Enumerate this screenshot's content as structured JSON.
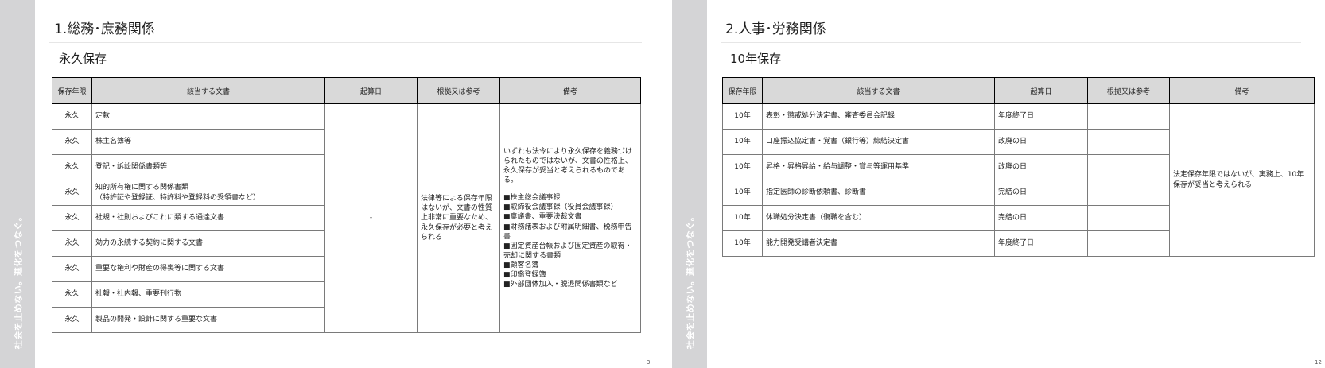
{
  "side_band_text": "社会を止めない。進化をつなぐ。",
  "left_slide": {
    "title": "1.総務･庶務関係",
    "subtitle": "永久保存",
    "page_number": "3",
    "headers": [
      "保存年限",
      "該当する文書",
      "起算日",
      "根拠又は参考",
      "備考"
    ],
    "rows": [
      {
        "period": "永久",
        "doc": "定款"
      },
      {
        "period": "永久",
        "doc": "株主名簿等"
      },
      {
        "period": "永久",
        "doc": "登記・訴訟関係書類等"
      },
      {
        "period": "永久",
        "doc": "知的所有権に関する関係書類",
        "doc2": "（特許証や登録証、特許料や登録料の受領書など）"
      },
      {
        "period": "永久",
        "doc": "社規・社則およびこれに類する通達文書"
      },
      {
        "period": "永久",
        "doc": "効力の永続する契約に関する文書"
      },
      {
        "period": "永久",
        "doc": "重要な権利や財産の得喪等に関する文書"
      },
      {
        "period": "永久",
        "doc": "社報・社内報、重要刊行物"
      },
      {
        "period": "永久",
        "doc": "製品の開発・設計に関する重要な文書"
      }
    ],
    "start_date_merged": "-",
    "basis_merged": "法律等による保存年限はないが、文書の性質上非常に重要なため、永久保存が必要と考えられる",
    "remarks_intro": "いずれも法令により永久保存を義務づけられたものではないが、文書の性格上、永久保存が妥当と考えられるものである。",
    "remarks_items": [
      "■株主総会議事録",
      "■取締役会議事録（役員会議事録）",
      "■稟議書、重要決裁文書",
      "■財務諸表および附属明細書、税務申告書",
      "■固定資産台帳および固定資産の取得・売却に関する書類",
      "■顧客名簿",
      "■印鑑登録簿",
      "■外部団体加入・脱退関係書類など"
    ]
  },
  "right_slide": {
    "title": "2.人事･労務関係",
    "subtitle": "10年保存",
    "page_number": "12",
    "headers": [
      "保存年限",
      "該当する文書",
      "起算日",
      "根拠又は参考",
      "備考"
    ],
    "rows": [
      {
        "period": "10年",
        "doc": "表彰・懲戒処分決定書、審査委員会記録",
        "start": "年度終了日",
        "basis": ""
      },
      {
        "period": "10年",
        "doc": "口座振込協定書・覚書（銀行等）締結決定書",
        "start": "改廃の日",
        "basis": ""
      },
      {
        "period": "10年",
        "doc": "昇格・昇格昇給・給与調整・賞与等運用基準",
        "start": "改廃の日",
        "basis": ""
      },
      {
        "period": "10年",
        "doc": "指定医師の診断依頼書、診断書",
        "start": "完結の日",
        "basis": ""
      },
      {
        "period": "10年",
        "doc": "休職処分決定書（復職を含む）",
        "start": "完結の日",
        "basis": ""
      },
      {
        "period": "10年",
        "doc": "能力開発受講者決定書",
        "start": "年度終了日",
        "basis": ""
      }
    ],
    "remarks_merged": "法定保存年限ではないが、実務上、10年保存が妥当と考えられる"
  }
}
